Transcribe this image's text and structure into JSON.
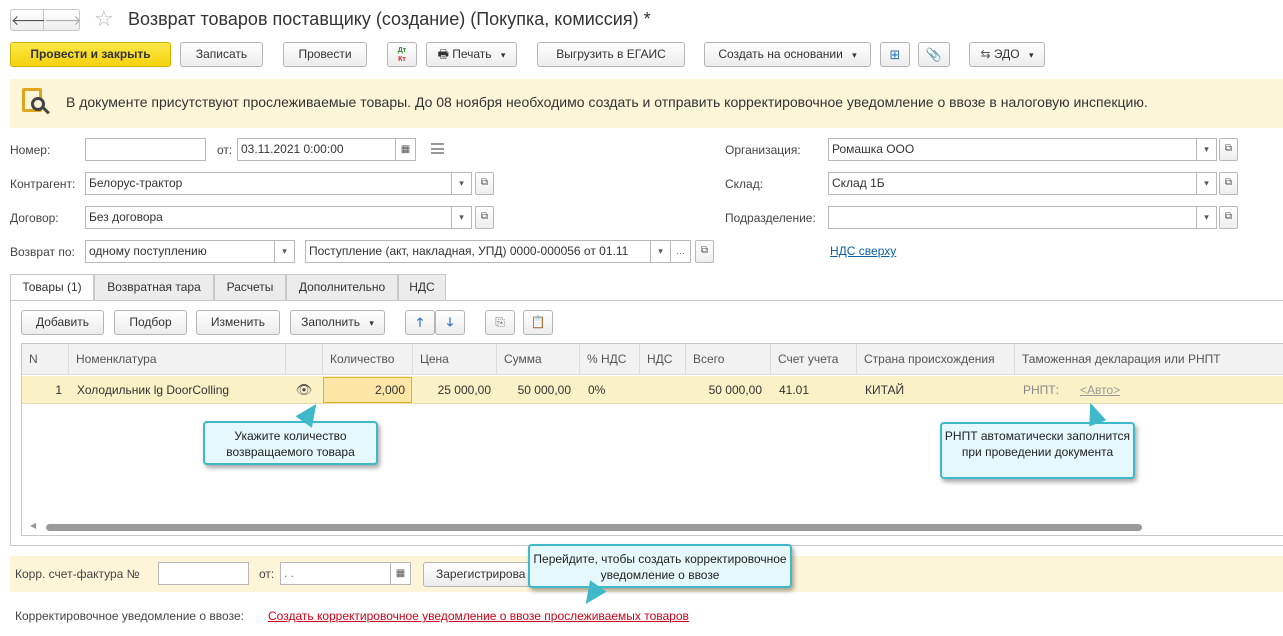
{
  "window": {
    "title": "Возврат товаров поставщику (создание) (Покупка, комиссия) *"
  },
  "toolbar": {
    "post_close": "Провести и закрыть",
    "save": "Записать",
    "post": "Провести",
    "dt_kt": "Дт Кт",
    "print": "Печать",
    "egais": "Выгрузить в ЕГАИС",
    "create_based": "Создать на основании",
    "edo": "ЭДО"
  },
  "notice": {
    "text": "В документе присутствуют прослеживаемые товары. До 08 ноября необходимо создать и отправить корректировочное уведомление о ввозе в налоговую инспекцию."
  },
  "form": {
    "number_label": "Номер:",
    "number_value": "",
    "from_label": "от:",
    "date_value": "03.11.2021  0:00:00",
    "counterparty_label": "Контрагент:",
    "counterparty_value": "Белорус-трактор",
    "contract_label": "Договор:",
    "contract_value": "Без договора",
    "return_by_label": "Возврат по:",
    "return_by_value": "одному поступлению",
    "receipt_value": "Поступление (акт, накладная, УПД) 0000-000056 от 01.11",
    "organization_label": "Организация:",
    "organization_value": "Ромашка ООО",
    "warehouse_label": "Склад:",
    "warehouse_value": "Склад 1Б",
    "division_label": "Подразделение:",
    "division_value": "",
    "vat_link": "НДС сверху"
  },
  "tabs": [
    {
      "label": "Товары (1)"
    },
    {
      "label": "Возвратная тара"
    },
    {
      "label": "Расчеты"
    },
    {
      "label": "Дополнительно"
    },
    {
      "label": "НДС"
    }
  ],
  "table_toolbar": {
    "add": "Добавить",
    "select": "Подбор",
    "edit": "Изменить",
    "fill": "Заполнить"
  },
  "table": {
    "headers": [
      "N",
      "Номенклатура",
      "",
      "Количество",
      "Цена",
      "Сумма",
      "% НДС",
      "НДС",
      "Всего",
      "Счет учета",
      "Страна происхождения",
      "Таможенная декларация или РНПТ"
    ],
    "rows": [
      {
        "n": "1",
        "item": "Холодильник lg DoorColling",
        "qty": "2,000",
        "price": "25 000,00",
        "sum": "50 000,00",
        "vat_rate": "0%",
        "vat": "",
        "total": "50 000,00",
        "account": "41.01",
        "country": "КИТАЙ",
        "rnpt_label": "РНПТ:",
        "rnpt_value": "<Авто>"
      }
    ]
  },
  "callouts": {
    "qty": "Укажите количество возвращаемого товара",
    "rnpt": "РНПТ автоматически заполнится при проведении документа",
    "notice": "Перейдите, чтобы создать корректировочное уведомление о ввозе"
  },
  "footer": {
    "corr_invoice_label": "Корр. счет-фактура №",
    "corr_invoice_value": "",
    "from_label": "от:",
    "date_value": " .  .",
    "register_btn": "Зарегистрирова",
    "notice_label": "Корректировочное уведомление о ввозе:",
    "notice_link": "Создать корректировочное уведомление о ввозе прослеживаемых товаров"
  },
  "colors": {
    "primary_button": "#f5d20c",
    "notice_bg": "#fdf5d8",
    "selected_row": "#fbf1c7",
    "callout_bg": "#e5f8fc",
    "callout_border": "#3fb8c9",
    "link": "#0b5fa5",
    "error_link": "#d0021b"
  }
}
